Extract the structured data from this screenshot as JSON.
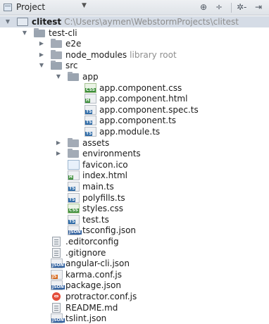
{
  "header": {
    "title": "Project",
    "dropdown_arrow": "▼",
    "sync_icon": "⊕",
    "collapse_icon": "÷",
    "settings_icon": "✲-",
    "hide_icon": "⇥"
  },
  "tree": [
    {
      "depth": 0,
      "expanded": true,
      "icon": "project-folder",
      "label": "clitest",
      "hint": "C:\\Users\\aymen\\WebstormProjects\\clitest",
      "bold": true
    },
    {
      "depth": 1,
      "expanded": true,
      "icon": "folder",
      "label": "test-cli"
    },
    {
      "depth": 2,
      "expanded": false,
      "icon": "folder",
      "label": "e2e"
    },
    {
      "depth": 2,
      "expanded": false,
      "icon": "folder",
      "label": "node_modules",
      "hint": "library root"
    },
    {
      "depth": 2,
      "expanded": true,
      "icon": "folder",
      "label": "src"
    },
    {
      "depth": 3,
      "expanded": true,
      "icon": "folder",
      "label": "app"
    },
    {
      "depth": 4,
      "icon": "css",
      "label": "app.component.css"
    },
    {
      "depth": 4,
      "icon": "html",
      "label": "app.component.html"
    },
    {
      "depth": 4,
      "icon": "ts-spec",
      "label": "app.component.spec.ts"
    },
    {
      "depth": 4,
      "icon": "ts",
      "label": "app.component.ts"
    },
    {
      "depth": 4,
      "icon": "ts",
      "label": "app.module.ts"
    },
    {
      "depth": 3,
      "expanded": false,
      "icon": "folder",
      "label": "assets"
    },
    {
      "depth": 3,
      "expanded": false,
      "icon": "folder",
      "label": "environments"
    },
    {
      "depth": 3,
      "icon": "ico",
      "label": "favicon.ico"
    },
    {
      "depth": 3,
      "icon": "html",
      "label": "index.html"
    },
    {
      "depth": 3,
      "icon": "ts",
      "label": "main.ts"
    },
    {
      "depth": 3,
      "icon": "ts",
      "label": "polyfills.ts"
    },
    {
      "depth": 3,
      "icon": "css",
      "label": "styles.css"
    },
    {
      "depth": 3,
      "icon": "ts",
      "label": "test.ts"
    },
    {
      "depth": 3,
      "icon": "json",
      "label": "tsconfig.json"
    },
    {
      "depth": 2,
      "icon": "text",
      "label": ".editorconfig"
    },
    {
      "depth": 2,
      "icon": "text",
      "label": ".gitignore"
    },
    {
      "depth": 2,
      "icon": "json",
      "label": "angular-cli.json"
    },
    {
      "depth": 2,
      "icon": "js",
      "label": "karma.conf.js"
    },
    {
      "depth": 2,
      "icon": "json",
      "label": "package.json"
    },
    {
      "depth": 2,
      "icon": "protractor",
      "label": "protractor.conf.js"
    },
    {
      "depth": 2,
      "icon": "text",
      "label": "README.md"
    },
    {
      "depth": 2,
      "icon": "json",
      "label": "tslint.json"
    }
  ],
  "icon_badges": {
    "css": {
      "text": "CSS",
      "color": "#3d8f3a"
    },
    "html": {
      "text": "H",
      "color": "#3d8f3a"
    },
    "ts": {
      "text": "TS",
      "color": "#2f6ca8"
    },
    "ts-spec": {
      "text": "TS",
      "color": "#2f6ca8"
    },
    "json": {
      "text": "JSON",
      "color": "#2f5f9e"
    },
    "js": {
      "text": "JS",
      "color": "#d86b1f"
    }
  }
}
